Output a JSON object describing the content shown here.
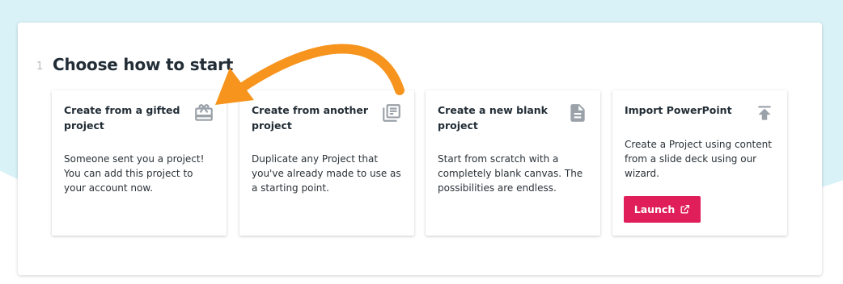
{
  "section": {
    "step_number": "1",
    "heading": "Choose how to start"
  },
  "cards": [
    {
      "title": "Create from a gifted project",
      "description": "Someone sent you a project! You can add this project to your account now.",
      "icon": "gift-icon"
    },
    {
      "title": "Create from another project",
      "description": "Duplicate any Project that you've already made to use as a starting point.",
      "icon": "library-books-icon"
    },
    {
      "title": "Create a new blank project",
      "description": "Start from scratch with a completely blank canvas. The possibilities are endless.",
      "icon": "document-icon"
    },
    {
      "title": "Import PowerPoint",
      "description": "Create a Project using content from a slide deck using our wizard.",
      "icon": "upload-icon",
      "button_label": "Launch",
      "button_icon": "external-link-icon"
    }
  ],
  "colors": {
    "background_tint": "#d9f2f7",
    "heading_text": "#222d36",
    "icon_gray": "#9aa1a8",
    "launch_button": "#e01e5a",
    "annotation_arrow": "#f7941d"
  }
}
